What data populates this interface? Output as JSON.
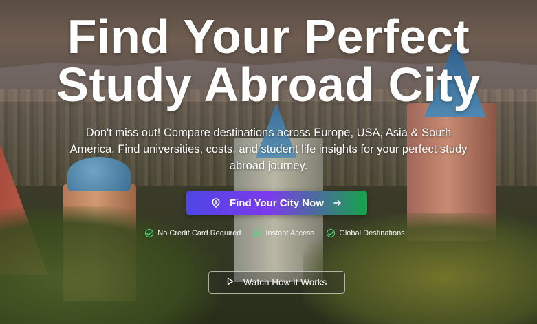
{
  "hero": {
    "title_line1": "Find Your Perfect",
    "title_line2": "Study Abroad City",
    "subtitle": "Don't miss out! Compare destinations across Europe, USA, Asia & South America. Find universities, costs, and student life insights for your perfect study abroad journey.",
    "cta_label": "Find Your City Now",
    "cta_icon": "map-pin-icon",
    "cta_arrow_icon": "arrow-right-icon",
    "badges": [
      {
        "label": "No Credit Card Required",
        "icon": "check-circle-icon"
      },
      {
        "label": "Instant Access",
        "icon": "check-circle-icon"
      },
      {
        "label": "Global Destinations",
        "icon": "check-circle-icon"
      }
    ],
    "watch_label": "Watch How It Works",
    "watch_icon": "play-icon"
  },
  "colors": {
    "cta_gradient_start": "#4f46e5",
    "cta_gradient_mid": "#7c3aed",
    "cta_gradient_end": "#16a34a",
    "check_color": "#4ade80",
    "text": "#ffffff"
  }
}
